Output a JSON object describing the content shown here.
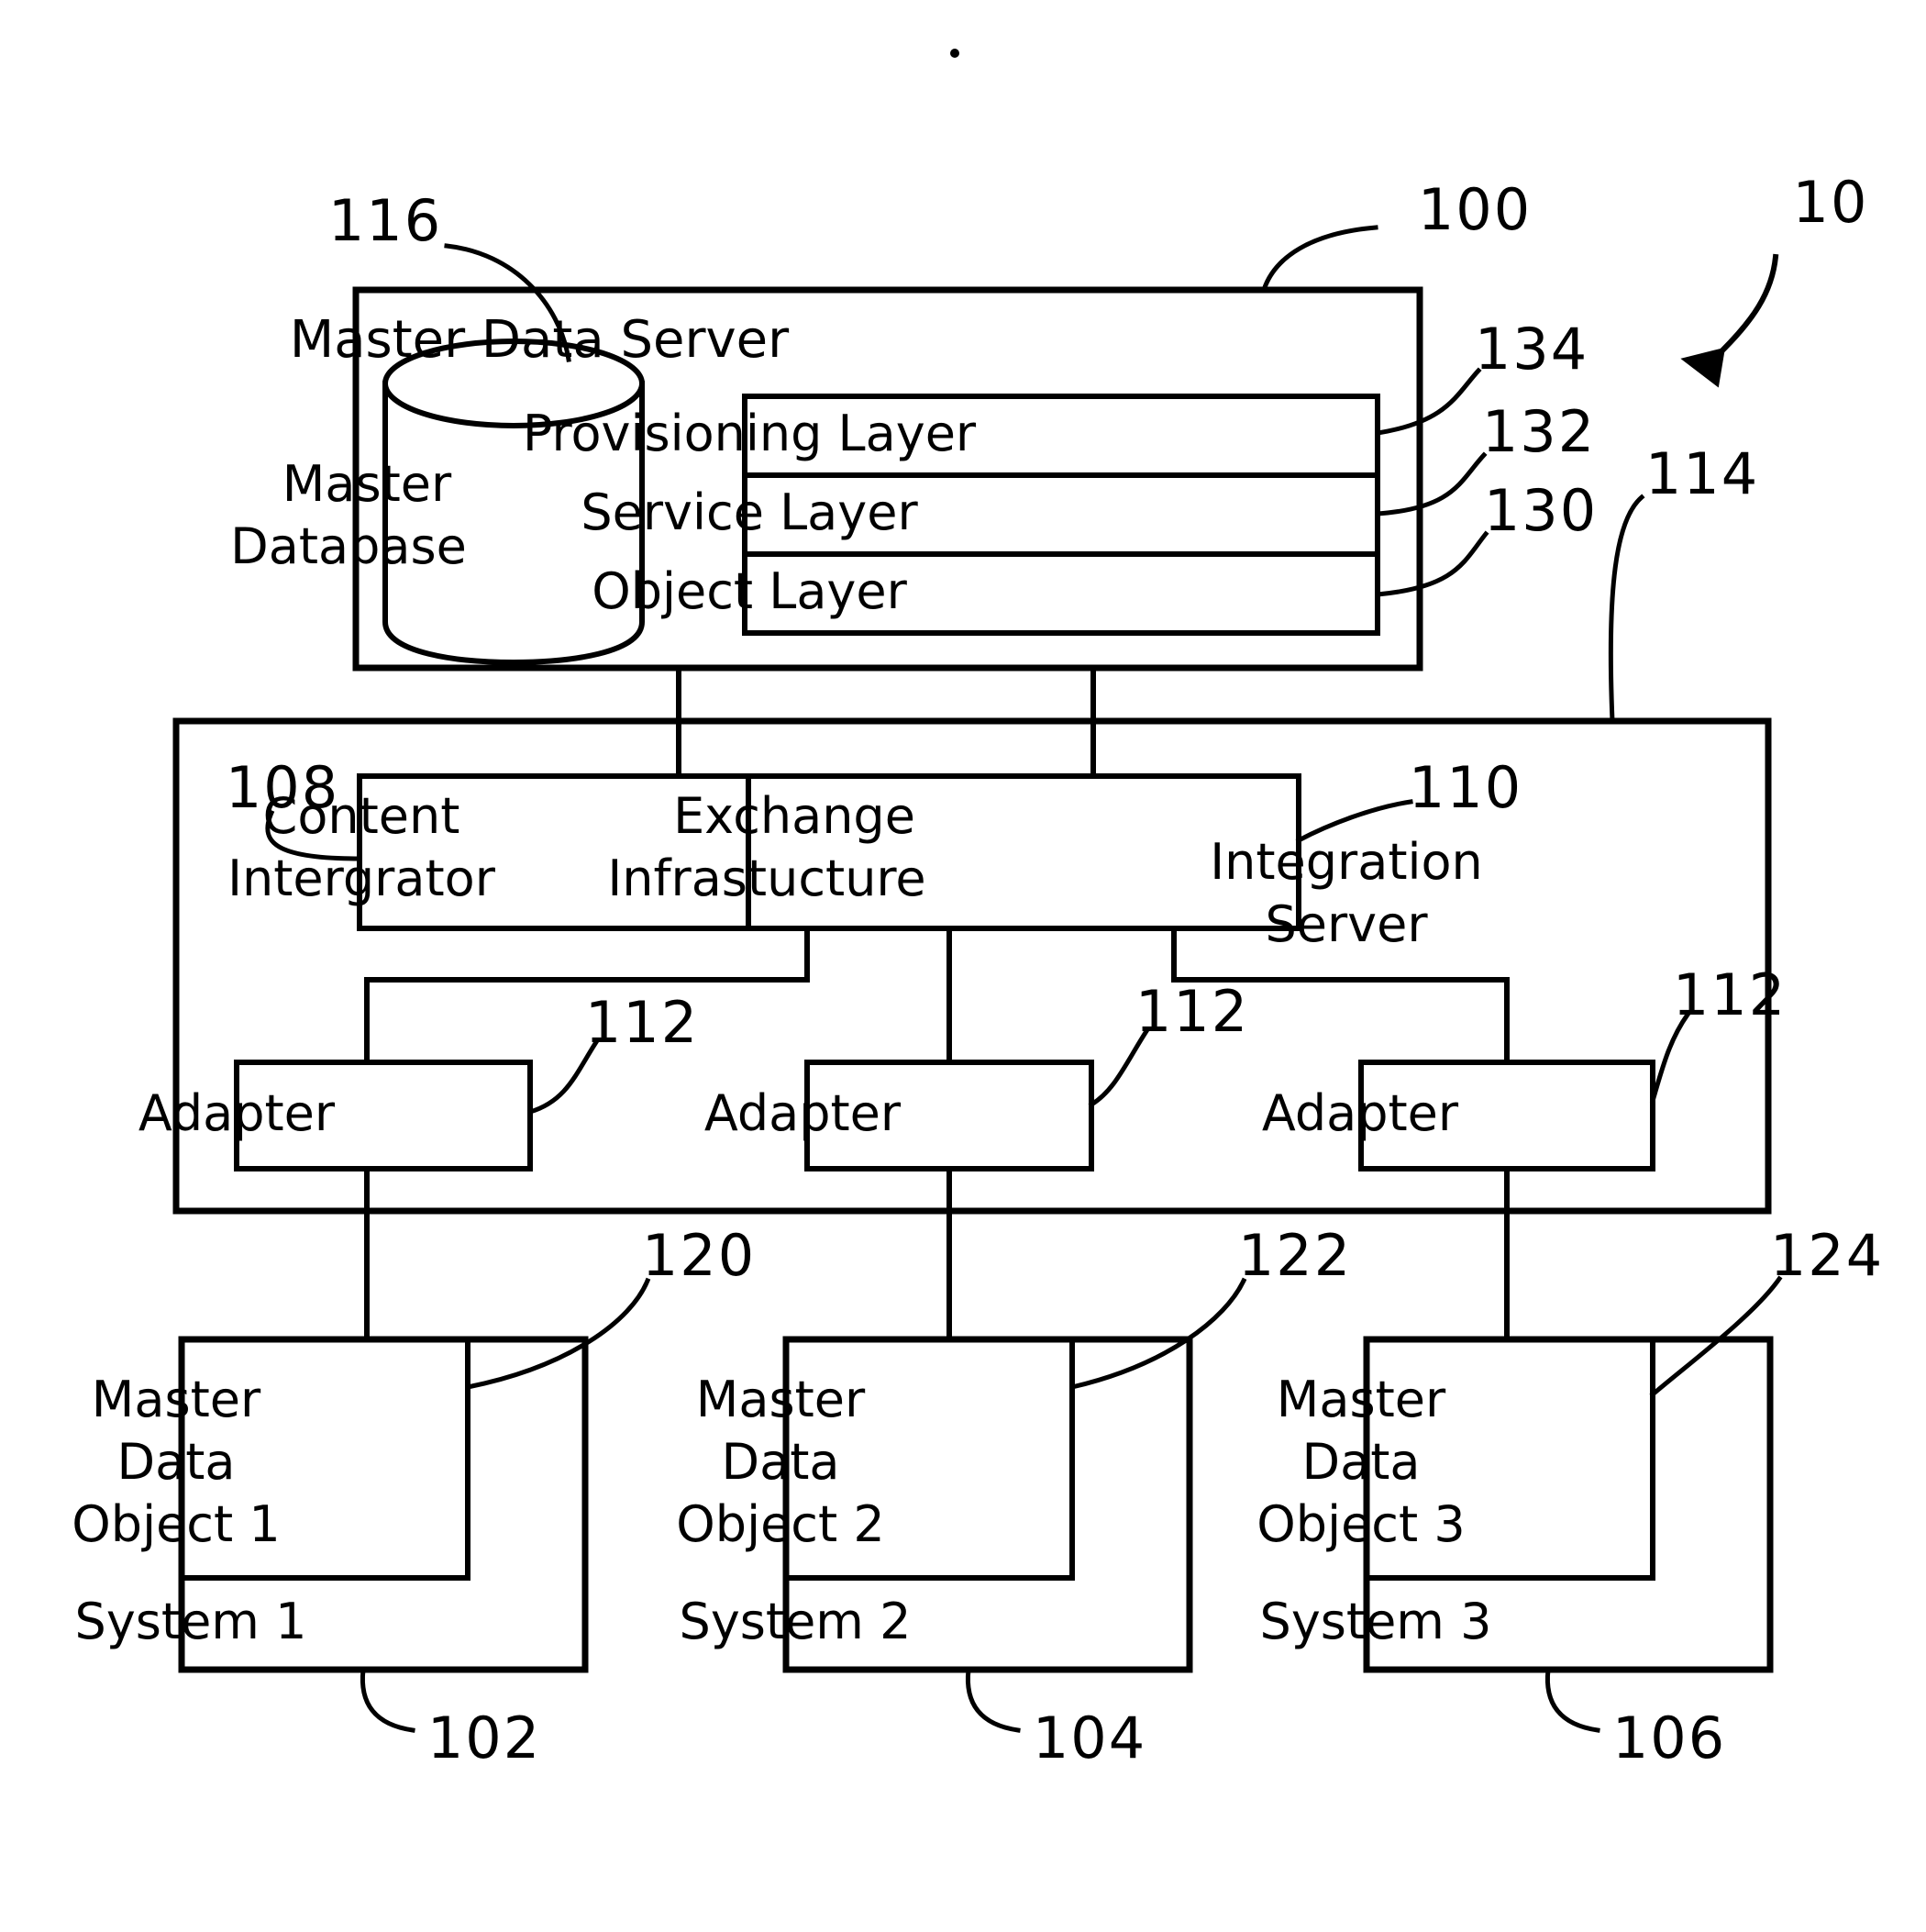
{
  "figure": {
    "system_ref": "10",
    "master_data_server": {
      "title": "Master Data Server",
      "ref": "100",
      "database": {
        "line1": "Master",
        "line2": "Database",
        "ref": "116"
      },
      "layers": [
        {
          "label": "Provisioning Layer",
          "ref": "134"
        },
        {
          "label": "Service Layer",
          "ref": "132"
        },
        {
          "label": "Object Layer",
          "ref": "130"
        }
      ]
    },
    "integration_server": {
      "title_line1": "Integration",
      "title_line2": "Server",
      "ref": "114",
      "components": [
        {
          "line1": "Content",
          "line2": "Intergrator",
          "ref": "108"
        },
        {
          "line1": "Exchange",
          "line2": "Infrastucture",
          "ref": "110"
        }
      ],
      "adapters": [
        {
          "label": "Adapter",
          "ref": "112"
        },
        {
          "label": "Adapter",
          "ref": "112"
        },
        {
          "label": "Adapter",
          "ref": "112"
        }
      ]
    },
    "systems": [
      {
        "object_line1": "Master",
        "object_line2": "Data",
        "object_line3": "Object 1",
        "object_ref": "120",
        "system_label": "System 1",
        "system_ref": "102"
      },
      {
        "object_line1": "Master",
        "object_line2": "Data",
        "object_line3": "Object 2",
        "object_ref": "122",
        "system_label": "System 2",
        "system_ref": "104"
      },
      {
        "object_line1": "Master",
        "object_line2": "Data",
        "object_line3": "Object 3",
        "object_ref": "124",
        "system_label": "System 3",
        "system_ref": "106"
      }
    ]
  },
  "colors": {
    "ink": "#000000",
    "paper": "#ffffff"
  }
}
